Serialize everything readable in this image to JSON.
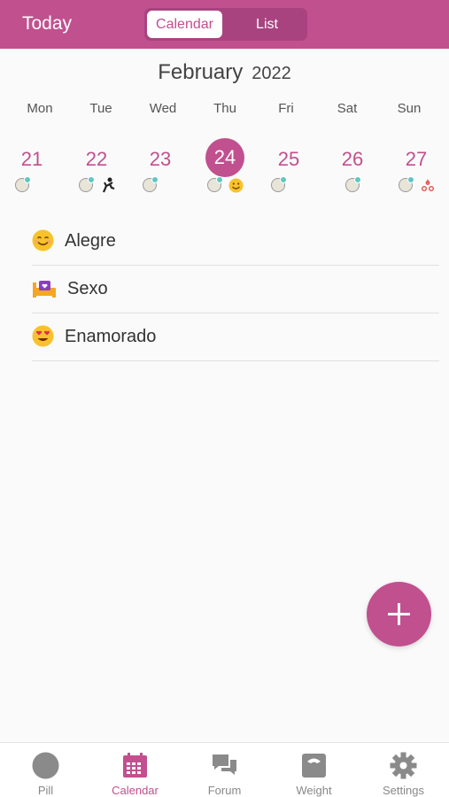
{
  "header": {
    "today_label": "Today",
    "segments": [
      "Calendar",
      "List"
    ],
    "selected_segment": "Calendar"
  },
  "calendar": {
    "month": "February",
    "year": "2022",
    "weekdays": [
      "Mon",
      "Tue",
      "Wed",
      "Thu",
      "Fri",
      "Sat",
      "Sun"
    ],
    "days": [
      "21",
      "22",
      "23",
      "24",
      "25",
      "26",
      "27"
    ],
    "selected_day": "24",
    "day_icons": {
      "21": [
        "pill-icon"
      ],
      "22": [
        "pill-icon",
        "activity-icon"
      ],
      "23": [
        "pill-icon"
      ],
      "24": [
        "pill-icon",
        "happy-face-icon"
      ],
      "25": [
        "pill-icon"
      ],
      "26": [
        "pill-icon"
      ],
      "27": [
        "pill-icon",
        "blood-drops-icon"
      ]
    }
  },
  "entries": [
    {
      "icon": "happy-face-icon",
      "label": "Alegre"
    },
    {
      "icon": "bed-heart-icon",
      "label": "Sexo"
    },
    {
      "icon": "heart-eyes-face-icon",
      "label": "Enamorado"
    }
  ],
  "fab": {
    "icon": "plus-icon"
  },
  "tabbar": {
    "items": [
      {
        "label": "Pill",
        "icon": "pill-circle-icon"
      },
      {
        "label": "Calendar",
        "icon": "calendar-icon"
      },
      {
        "label": "Forum",
        "icon": "chat-bubbles-icon"
      },
      {
        "label": "Weight",
        "icon": "scale-icon"
      },
      {
        "label": "Settings",
        "icon": "gear-icon"
      }
    ],
    "active": "Calendar"
  },
  "colors": {
    "accent": "#c1508f",
    "segment_track": "#a94380",
    "background": "#fafafa",
    "pill_dot": "#5ec8c2"
  }
}
